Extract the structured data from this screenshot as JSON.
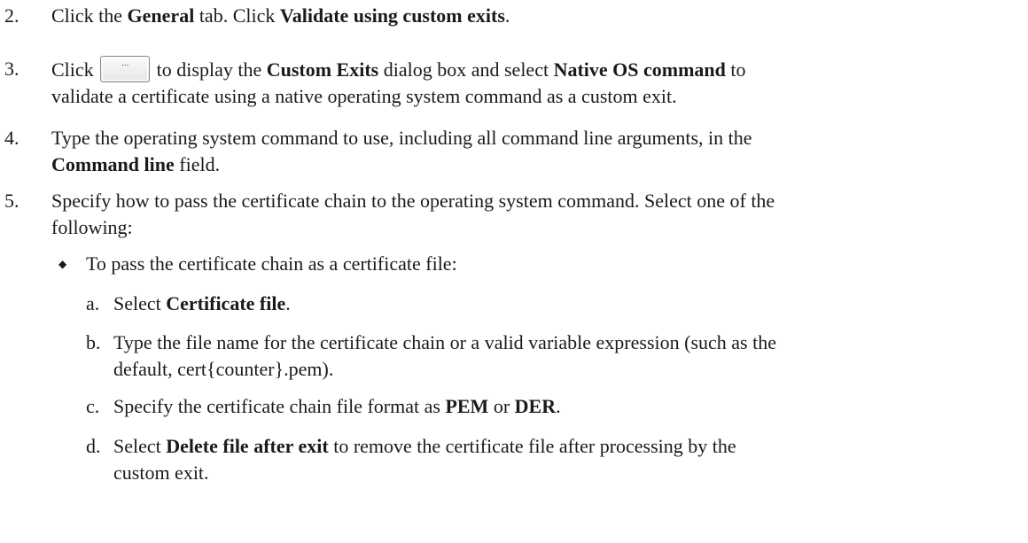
{
  "step2": {
    "number": "2.",
    "t1": "Click the ",
    "b1": "General",
    "t2": " tab. Click ",
    "b2": "Validate using custom exits",
    "t3": "."
  },
  "step3": {
    "number": "3.",
    "t1": "Click ",
    "button_label": "...",
    "t2": " to display the ",
    "b1": "Custom Exits",
    "t3": " dialog box and select ",
    "b2": "Native OS command",
    "t4": " to",
    "line2": "validate a certificate using a native operating system command as a custom exit."
  },
  "step4": {
    "number": "4.",
    "line1": "Type the operating system command to use, including all command line arguments, in the",
    "b1": "Command line",
    "t1": " field."
  },
  "step5": {
    "number": "5.",
    "line1": "Specify how to pass the certificate chain to the operating system command. Select one of the",
    "line2": "following:"
  },
  "bullet1": {
    "symbol": "◆",
    "text": "To pass the certificate chain as a certificate file:"
  },
  "sub_a": {
    "number": "a.",
    "t1": "Select ",
    "b1": "Certificate file",
    "t2": "."
  },
  "sub_b": {
    "number": "b.",
    "line1": "Type the file name for the certificate chain or a valid variable expression (such as the",
    "line2": "default, cert{counter}.pem)."
  },
  "sub_c": {
    "number": "c.",
    "t1": "Specify the certificate chain file format as ",
    "b1": "PEM",
    "t2": " or ",
    "b2": "DER",
    "t3": "."
  },
  "sub_d": {
    "number": "d.",
    "t1": "Select ",
    "b1": "Delete file after exit",
    "t2": " to remove the certificate file after processing by the",
    "line2": "custom exit."
  }
}
